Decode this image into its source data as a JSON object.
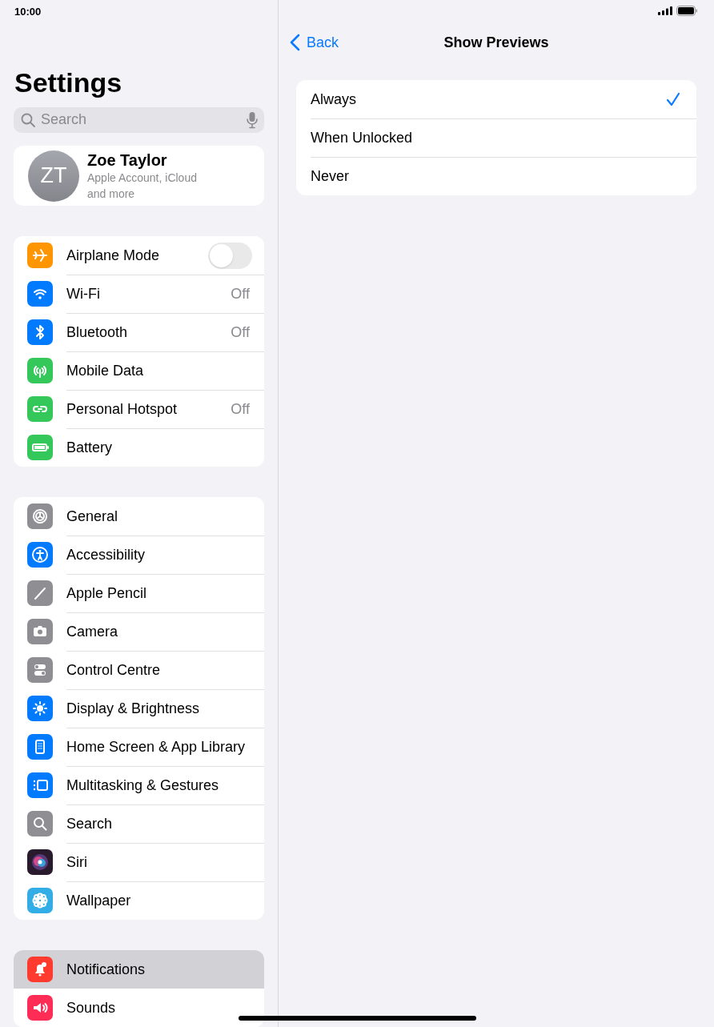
{
  "status_bar": {
    "time": "10:00"
  },
  "sidebar": {
    "title": "Settings",
    "search": {
      "placeholder": "Search"
    },
    "profile": {
      "initials": "ZT",
      "name": "Zoe Taylor",
      "subtitle": "Apple Account, iCloud and more"
    },
    "groups": [
      [
        {
          "label": "Airplane Mode",
          "kind": "toggle",
          "on": false,
          "selected": false
        },
        {
          "label": "Wi-Fi",
          "kind": "link",
          "value": "Off",
          "selected": false
        },
        {
          "label": "Bluetooth",
          "kind": "link",
          "value": "Off",
          "selected": false
        },
        {
          "label": "Mobile Data",
          "kind": "link",
          "selected": false
        },
        {
          "label": "Personal Hotspot",
          "kind": "link",
          "value": "Off",
          "selected": false
        },
        {
          "label": "Battery",
          "kind": "link",
          "selected": false
        }
      ],
      [
        {
          "label": "General",
          "kind": "link",
          "selected": false
        },
        {
          "label": "Accessibility",
          "kind": "link",
          "selected": false
        },
        {
          "label": "Apple Pencil",
          "kind": "link",
          "selected": false
        },
        {
          "label": "Camera",
          "kind": "link",
          "selected": false
        },
        {
          "label": "Control Centre",
          "kind": "link",
          "selected": false
        },
        {
          "label": "Display & Brightness",
          "kind": "link",
          "selected": false
        },
        {
          "label": "Home Screen & App Library",
          "kind": "link",
          "selected": false
        },
        {
          "label": "Multitasking & Gestures",
          "kind": "link",
          "selected": false
        },
        {
          "label": "Search",
          "kind": "link",
          "selected": false
        },
        {
          "label": "Siri",
          "kind": "link",
          "selected": false
        },
        {
          "label": "Wallpaper",
          "kind": "link",
          "selected": false
        }
      ],
      [
        {
          "label": "Notifications",
          "kind": "link",
          "selected": true
        },
        {
          "label": "Sounds",
          "kind": "link",
          "selected": false
        }
      ]
    ]
  },
  "detail": {
    "back": "Back",
    "title": "Show Previews",
    "options": [
      {
        "label": "Always",
        "selected": true
      },
      {
        "label": "When Unlocked",
        "selected": false
      },
      {
        "label": "Never",
        "selected": false
      }
    ]
  }
}
